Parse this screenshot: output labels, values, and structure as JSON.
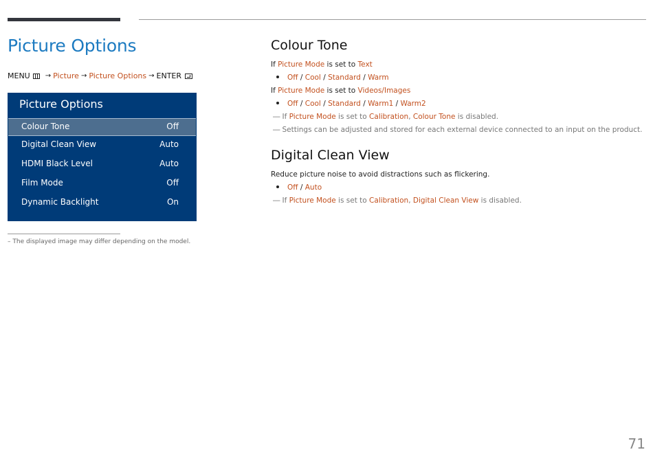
{
  "menu_path": {
    "menu_label": "MENU",
    "arrow": "→",
    "picture": "Picture",
    "picture_options": "Picture Options",
    "enter_label": "ENTER"
  },
  "page_title": "Picture Options",
  "osd": {
    "title": "Picture Options",
    "items": [
      {
        "label": "Colour Tone",
        "value": "Off",
        "selected": true
      },
      {
        "label": "Digital Clean View",
        "value": "Auto"
      },
      {
        "label": "HDMI Black Level",
        "value": "Auto"
      },
      {
        "label": "Film Mode",
        "value": "Off"
      },
      {
        "label": "Dynamic Backlight",
        "value": "On"
      }
    ],
    "colors": {
      "panel": "#003b78",
      "selected": "#4d6e8f"
    }
  },
  "footnote": "The displayed image may differ depending on the model.",
  "colour_tone": {
    "title": "Colour Tone",
    "text_mode": {
      "prefix": "If",
      "mode_key": "Picture Mode",
      "middle": "is set to",
      "mode_value": "Text"
    },
    "text_options": [
      "Off",
      "Cool",
      "Standard",
      "Warm"
    ],
    "video_mode": {
      "prefix": "If",
      "mode_key": "Picture Mode",
      "middle": "is set to",
      "mode_value": "Videos/Images"
    },
    "video_options": [
      "Off",
      "Cool",
      "Standard",
      "Warm1",
      "Warm2"
    ],
    "note1": {
      "prefix": "If",
      "mode_key": "Picture Mode",
      "middle": "is set to",
      "v1": "Calibration",
      "sep": ",",
      "v2": "Colour Tone",
      "suffix": "is disabled."
    },
    "note2": "Settings can be adjusted and stored for each external device connected to an input on the product."
  },
  "digital_clean_view": {
    "title": "Digital Clean View",
    "description": "Reduce picture noise to avoid distractions such as flickering.",
    "options": [
      "Off",
      "Auto"
    ],
    "note": {
      "prefix": "If",
      "mode_key": "Picture Mode",
      "middle": "is set to",
      "v1": "Calibration",
      "sep": ",",
      "v2": "Digital Clean View",
      "suffix": "is disabled."
    }
  },
  "note_dash": "―",
  "slash": "/",
  "page_number": "71",
  "colors": {
    "title_blue": "#1d7bc1",
    "highlight": "#c2501e"
  }
}
